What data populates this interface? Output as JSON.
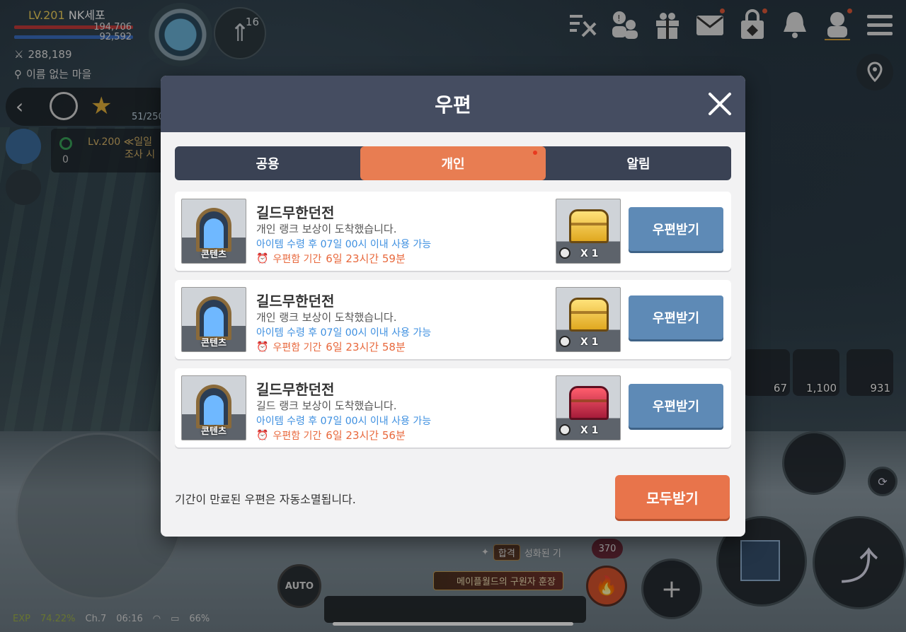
{
  "hud": {
    "level": "LV.201",
    "name": "NK세포",
    "hp": "194,706",
    "mp": "92,592",
    "power": "288,189",
    "map": "이름 없는 마을",
    "arrow_count": "16",
    "quest_counter": "51/250",
    "quest_level_line1": "Lv.200 ≪일일",
    "quest_level_line2": "조사 시",
    "quest_zero": "0",
    "items": [
      "67",
      "1,100",
      "931"
    ],
    "auto_label": "AUTO",
    "badge_370": "370",
    "banner_tag": "합격",
    "banner_text": "성화된 기",
    "banner2_text": "메이플월드의 구원자 훈장",
    "status_exp_label": "EXP",
    "status_exp": "74.22%",
    "status_ch": "Ch.7",
    "status_time": "06:16",
    "status_battery": "66%"
  },
  "mail_modal": {
    "title": "우편",
    "tabs": [
      {
        "label": "공용",
        "active": false
      },
      {
        "label": "개인",
        "active": true
      },
      {
        "label": "알림",
        "active": false
      }
    ],
    "mails": [
      {
        "thumb_label": "콘텐츠",
        "title": "길드무한던전",
        "desc": "개인 랭크 보상이 도착했습니다.",
        "use_note": "아이템 수령 후 07일 00시 이내 사용 가능",
        "expire_label": "우편함 기간",
        "expire_value": "6일 23시간 59분",
        "reward_qty": "X 1",
        "reward_chest": "gold",
        "button": "우편받기"
      },
      {
        "thumb_label": "콘텐츠",
        "title": "길드무한던전",
        "desc": "개인 랭크 보상이 도착했습니다.",
        "use_note": "아이템 수령 후 07일 00시 이내 사용 가능",
        "expire_label": "우편함 기간",
        "expire_value": "6일 23시간 58분",
        "reward_qty": "X 1",
        "reward_chest": "gold",
        "button": "우편받기"
      },
      {
        "thumb_label": "콘텐츠",
        "title": "길드무한던전",
        "desc": "길드 랭크 보상이 도착했습니다.",
        "use_note": "아이템 수령 후 07일 00시 이내 사용 가능",
        "expire_label": "우편함 기간",
        "expire_value": "6일 23시간 56분",
        "reward_qty": "X 1",
        "reward_chest": "red",
        "button": "우편받기"
      }
    ],
    "footer_note": "기간이 만료된 우편은 자동소멸됩니다.",
    "receive_all": "모두받기"
  },
  "colors": {
    "accent_orange": "#e8744b",
    "header": "#454d61",
    "button_blue": "#5e8ab6",
    "link_blue": "#3d8fe0",
    "expire_orange": "#e8683c"
  },
  "icons": {
    "top_right": [
      "tools-icon",
      "friends-icon",
      "gift-icon",
      "mail-icon",
      "cash-shop-icon",
      "bell-icon",
      "character-icon",
      "menu-icon"
    ]
  }
}
